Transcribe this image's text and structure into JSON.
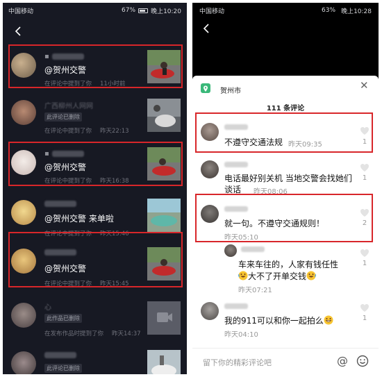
{
  "left": {
    "status": {
      "carrier": "中国移动",
      "battery": "67%",
      "time": "晚上10:20"
    },
    "messages": [
      {
        "mention": "@贺州交警",
        "meta": "在评论中提到了你",
        "time": "11小时前"
      },
      {
        "name": "广西柳州人网网",
        "tag": "此评论已删除",
        "meta": "在评论中提到了你",
        "time": "昨天22:13"
      },
      {
        "mention": "@贺州交警",
        "meta": "在评论中提到了你",
        "time": "昨天16:38"
      },
      {
        "mention": "@贺州交警 来单啦",
        "meta": "在评论中提到了你",
        "time": "昨天15:46"
      },
      {
        "mention": "@贺州交警",
        "meta": "在评论中提到了你",
        "time": "昨天15:45"
      },
      {
        "name": "心",
        "tag": "此作品已删除",
        "meta": "在发布作品时提到了你",
        "time": "昨天14:37"
      },
      {
        "tag": "此评论已删除"
      }
    ]
  },
  "right": {
    "status": {
      "carrier": "中国移动",
      "battery": "63%",
      "time": "晚上10:28"
    },
    "location": "贺州市",
    "comment_count": "111 条评论",
    "comments": [
      {
        "text": "不遵守交通法规",
        "time": "昨天09:35",
        "likes": "1"
      },
      {
        "text": "电话最好别关机 当地交警会找她们谈话",
        "time": "昨天08:06",
        "likes": "1"
      },
      {
        "text": "就一句。不遵守交通规则！",
        "time": "昨天05:10",
        "likes": "2"
      },
      {
        "text1": "车来车往的，人家有钱任性",
        "text2": "大不了开单交钱",
        "time": "昨天07:21",
        "likes": "1"
      },
      {
        "text": "我的911可以和你一起拍么",
        "time": "昨天04:10",
        "likes": "1"
      }
    ],
    "input_placeholder": "留下你的精彩评论吧",
    "at_symbol": "@"
  },
  "colors": {
    "highlight": "#d8262a",
    "dark_bg": "#171923",
    "location_icon": "#3ab879"
  },
  "icons": [
    "back-arrow-icon",
    "location-icon",
    "close-icon",
    "heart-icon",
    "at-icon",
    "emoji-icon",
    "laugh-cry-emoji",
    "grin-emoji",
    "video-placeholder-icon"
  ]
}
